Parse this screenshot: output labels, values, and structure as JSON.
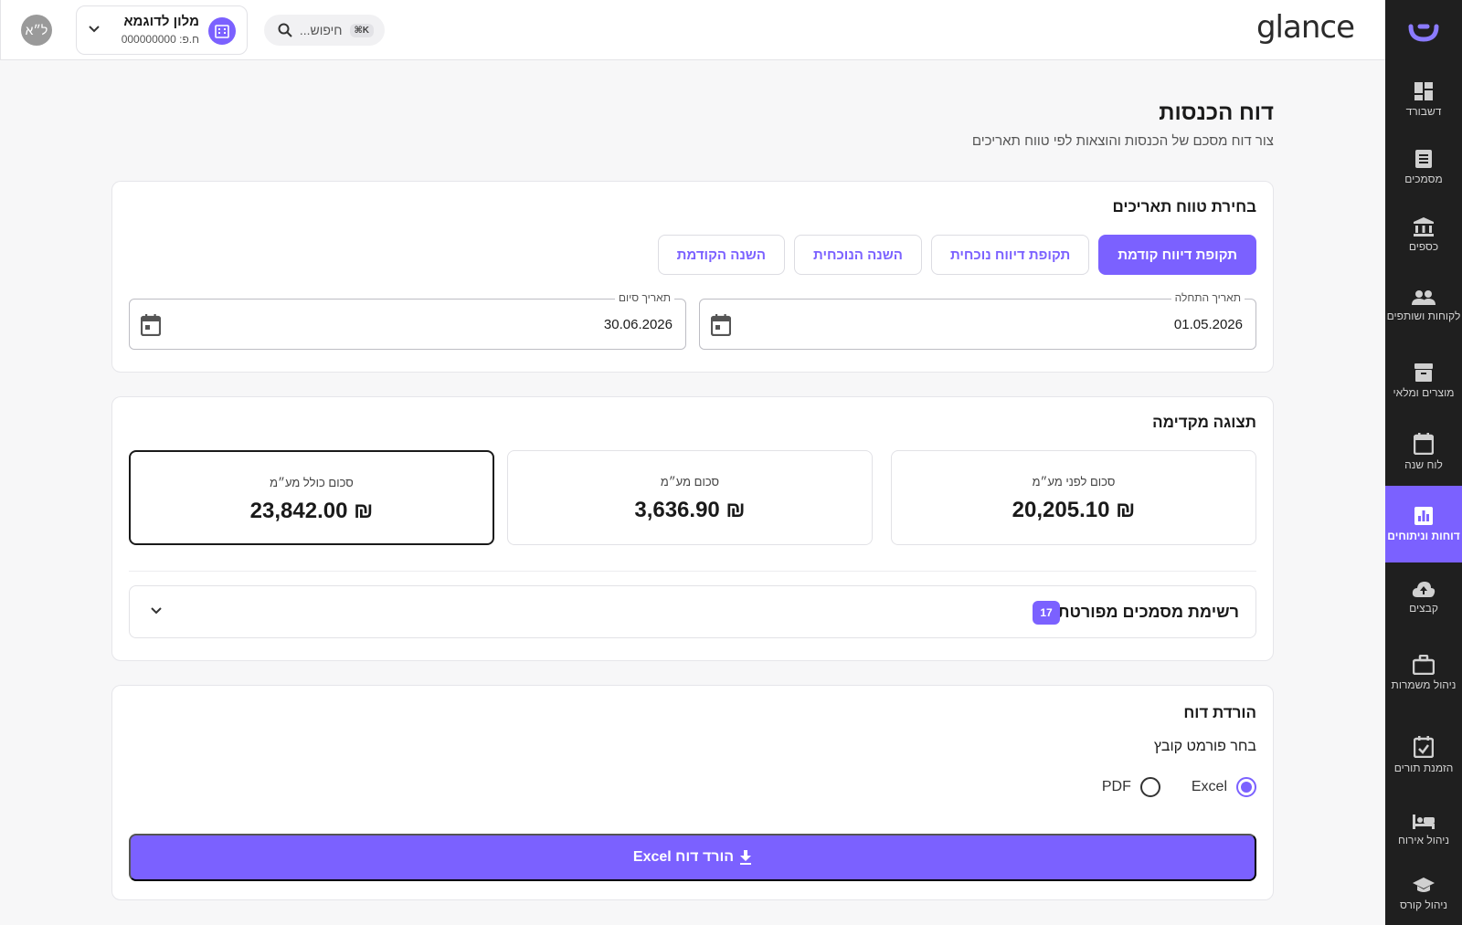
{
  "sidebar": {
    "items": [
      {
        "label": "דשבורד",
        "icon": "dashboard-icon"
      },
      {
        "label": "מסמכים",
        "icon": "documents-icon"
      },
      {
        "label": "כספים",
        "icon": "bank-icon"
      },
      {
        "label": "לקוחות ושותפים",
        "icon": "people-icon"
      },
      {
        "label": "מוצרים ומלאי",
        "icon": "archive-icon"
      },
      {
        "label": "לוח שנה",
        "icon": "calendar-icon"
      },
      {
        "label": "דוחות וניתוחים",
        "icon": "report-icon",
        "active": true
      },
      {
        "label": "קבצים",
        "icon": "cloud-upload-icon"
      },
      {
        "label": "ניהול משמרות",
        "icon": "briefcase-icon"
      },
      {
        "label": "הזמנת תורים",
        "icon": "calendar-check-icon"
      },
      {
        "label": "ניהול אירוח",
        "icon": "bed-icon"
      },
      {
        "label": "ניהול קורס",
        "icon": "school-icon"
      }
    ]
  },
  "header": {
    "brand": "glance",
    "search_placeholder": "חיפוש...",
    "search_shortcut": "⌘K",
    "business_name": "מלון לדוגמא",
    "business_id": "ח.פ: 000000000",
    "avatar_initials": "ל״א"
  },
  "page": {
    "title": "דוח הכנסות",
    "subtitle": "צור דוח מסכם של הכנסות והוצאות לפי טווח תאריכים"
  },
  "date_range": {
    "title": "בחירת טווח תאריכים",
    "buttons": [
      "תקופת דיווח קודמת",
      "תקופת דיווח נוכחית",
      "השנה הנוכחית",
      "השנה הקודמת"
    ],
    "start_label": "תאריך התחלה",
    "start_value": "01.05.2026",
    "end_label": "תאריך סיום",
    "end_value": "30.06.2026"
  },
  "preview": {
    "title": "תצוגה מקדימה",
    "before_vat_label": "סכום לפני מע״מ",
    "before_vat_value": "₪ 20,205.10",
    "vat_label": "סכום מע״מ",
    "vat_value": "₪ 3,636.90",
    "total_label": "סכום כולל מע״מ",
    "total_value": "₪ 23,842.00",
    "doc_list_title": "רשימת מסמכים מפורטת",
    "doc_count": "17"
  },
  "download": {
    "title": "הורדת דוח",
    "format_label": "בחר פורמט קובץ",
    "option_excel": "Excel",
    "option_pdf": "PDF",
    "selected": "Excel",
    "button_label": "הורד דוח Excel"
  },
  "colors": {
    "accent": "#7b61ff",
    "sidebar_bg": "#1f1f1f"
  }
}
